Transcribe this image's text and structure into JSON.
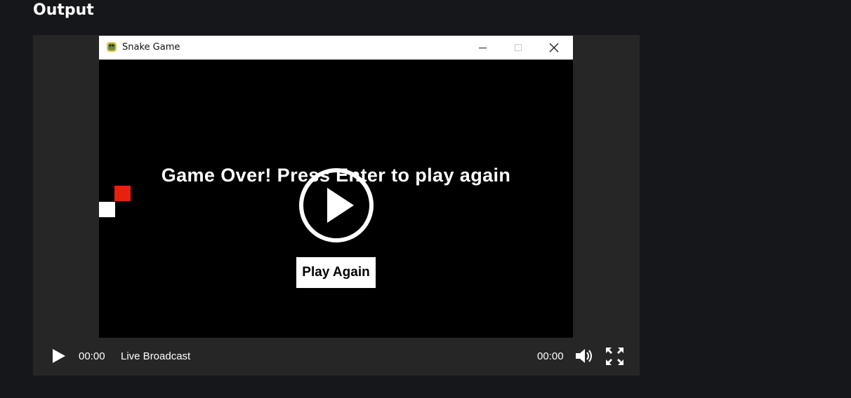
{
  "page": {
    "heading": "Output"
  },
  "window": {
    "title": "Snake Game",
    "app_icon": "python-snake-icon",
    "buttons": [
      "minimize-icon",
      "maximize-icon",
      "close-icon"
    ]
  },
  "game": {
    "message": "Game Over! Press Enter to play again",
    "play_again_label": "Play Again",
    "colors": {
      "background": "#000000",
      "food": "#e8210c",
      "snake": "#ffffff"
    }
  },
  "player": {
    "current_time": "00:00",
    "live_label": "Live Broadcast",
    "duration": "00:00",
    "icons": [
      "play-icon",
      "volume-icon",
      "fullscreen-icon"
    ]
  }
}
